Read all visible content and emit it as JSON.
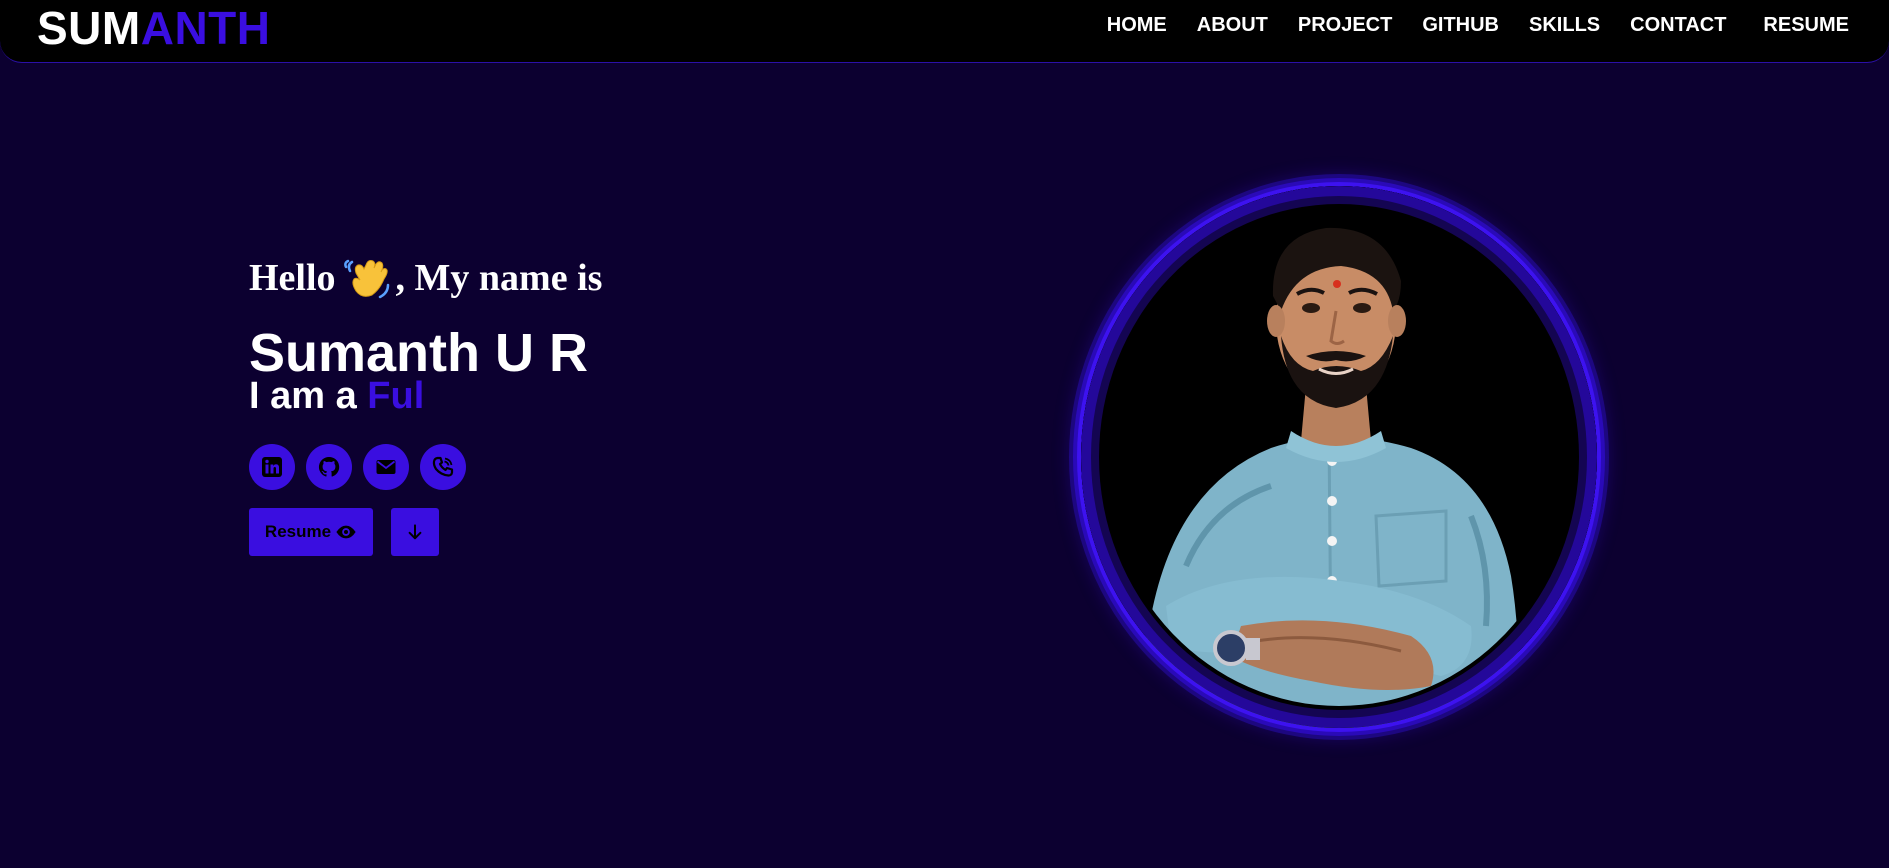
{
  "navbar": {
    "logo_part1": "SUM",
    "logo_part2": "ANTH",
    "links": [
      {
        "label": "HOME"
      },
      {
        "label": "ABOUT"
      },
      {
        "label": "PROJECT"
      },
      {
        "label": "GITHUB"
      },
      {
        "label": "SKILLS"
      },
      {
        "label": "CONTACT"
      },
      {
        "label": "RESUME"
      }
    ]
  },
  "hero": {
    "greeting_before": "Hello",
    "greeting_after": ", My name is",
    "wave_icon": "waving-hand-icon",
    "name": "Sumanth U R",
    "role_prefix": "I am a",
    "role_typed": "Ful",
    "socials": [
      {
        "icon": "linkedin-icon"
      },
      {
        "icon": "github-icon"
      },
      {
        "icon": "mail-icon"
      },
      {
        "icon": "phone-icon"
      }
    ],
    "resume_button_label": "Resume",
    "resume_button_icon": "eye-icon",
    "download_button_icon": "arrow-down-icon"
  },
  "portrait": {
    "subject": "profile-photo"
  },
  "colors": {
    "background": "#0c0030",
    "navbar": "#000000",
    "accent": "#3a0ee0",
    "text": "#ffffff"
  }
}
